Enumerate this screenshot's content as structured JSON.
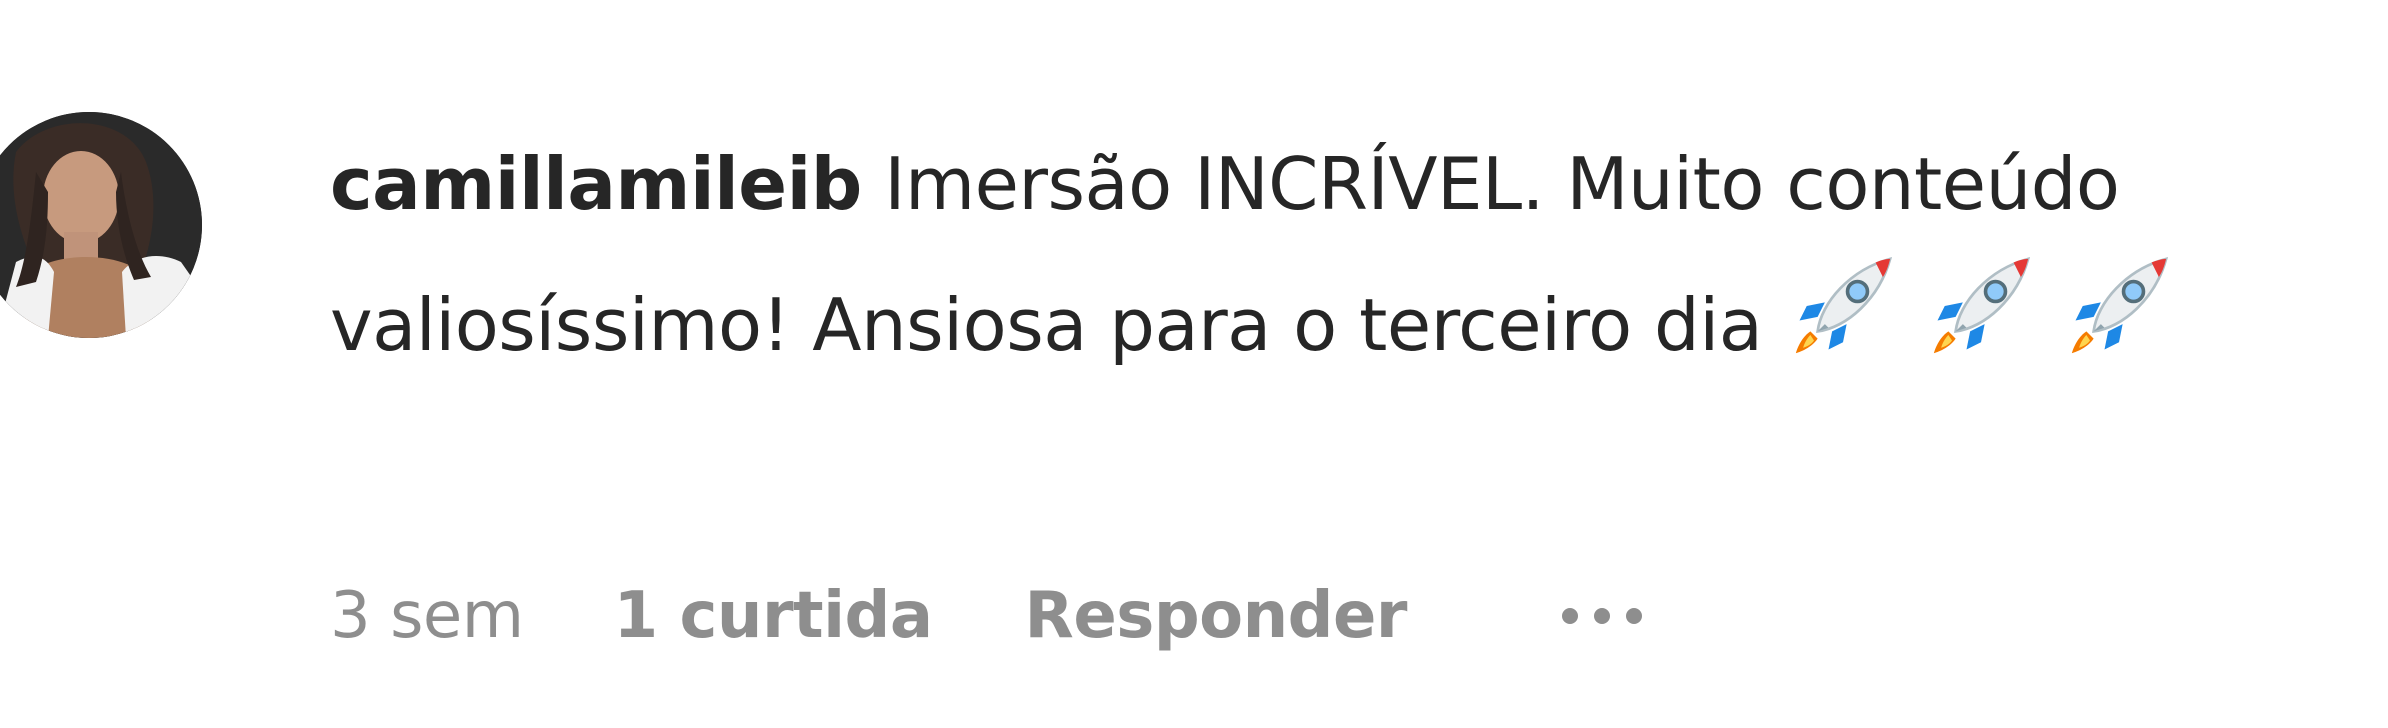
{
  "comment": {
    "username": "camillamileib",
    "text": " Imersão INCRÍVEL. Muito conteúdo valiosíssimo! Ansiosa para o terceiro dia ",
    "emojis": [
      "rocket-icon",
      "rocket-icon",
      "rocket-icon"
    ],
    "meta": {
      "time": "3 sem",
      "likes": "1 curtida",
      "reply": "Responder"
    }
  },
  "colors": {
    "text": "#262626",
    "secondary": "#8e8e8e",
    "background": "#ffffff"
  }
}
